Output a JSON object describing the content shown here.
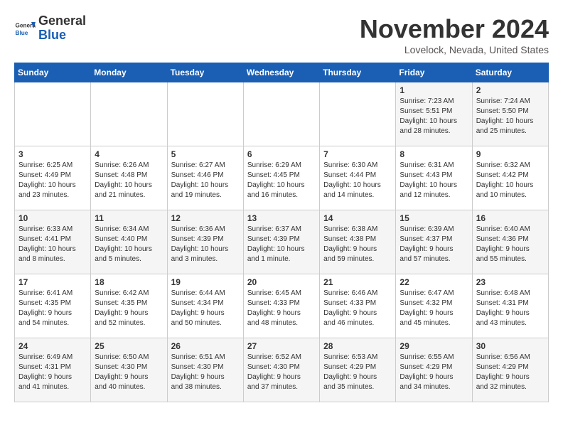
{
  "header": {
    "logo_general": "General",
    "logo_blue": "Blue",
    "month_title": "November 2024",
    "location": "Lovelock, Nevada, United States"
  },
  "calendar": {
    "days_of_week": [
      "Sunday",
      "Monday",
      "Tuesday",
      "Wednesday",
      "Thursday",
      "Friday",
      "Saturday"
    ],
    "weeks": [
      [
        {
          "day": "",
          "info": ""
        },
        {
          "day": "",
          "info": ""
        },
        {
          "day": "",
          "info": ""
        },
        {
          "day": "",
          "info": ""
        },
        {
          "day": "",
          "info": ""
        },
        {
          "day": "1",
          "info": "Sunrise: 7:23 AM\nSunset: 5:51 PM\nDaylight: 10 hours\nand 28 minutes."
        },
        {
          "day": "2",
          "info": "Sunrise: 7:24 AM\nSunset: 5:50 PM\nDaylight: 10 hours\nand 25 minutes."
        }
      ],
      [
        {
          "day": "3",
          "info": "Sunrise: 6:25 AM\nSunset: 4:49 PM\nDaylight: 10 hours\nand 23 minutes."
        },
        {
          "day": "4",
          "info": "Sunrise: 6:26 AM\nSunset: 4:48 PM\nDaylight: 10 hours\nand 21 minutes."
        },
        {
          "day": "5",
          "info": "Sunrise: 6:27 AM\nSunset: 4:46 PM\nDaylight: 10 hours\nand 19 minutes."
        },
        {
          "day": "6",
          "info": "Sunrise: 6:29 AM\nSunset: 4:45 PM\nDaylight: 10 hours\nand 16 minutes."
        },
        {
          "day": "7",
          "info": "Sunrise: 6:30 AM\nSunset: 4:44 PM\nDaylight: 10 hours\nand 14 minutes."
        },
        {
          "day": "8",
          "info": "Sunrise: 6:31 AM\nSunset: 4:43 PM\nDaylight: 10 hours\nand 12 minutes."
        },
        {
          "day": "9",
          "info": "Sunrise: 6:32 AM\nSunset: 4:42 PM\nDaylight: 10 hours\nand 10 minutes."
        }
      ],
      [
        {
          "day": "10",
          "info": "Sunrise: 6:33 AM\nSunset: 4:41 PM\nDaylight: 10 hours\nand 8 minutes."
        },
        {
          "day": "11",
          "info": "Sunrise: 6:34 AM\nSunset: 4:40 PM\nDaylight: 10 hours\nand 5 minutes."
        },
        {
          "day": "12",
          "info": "Sunrise: 6:36 AM\nSunset: 4:39 PM\nDaylight: 10 hours\nand 3 minutes."
        },
        {
          "day": "13",
          "info": "Sunrise: 6:37 AM\nSunset: 4:39 PM\nDaylight: 10 hours\nand 1 minute."
        },
        {
          "day": "14",
          "info": "Sunrise: 6:38 AM\nSunset: 4:38 PM\nDaylight: 9 hours\nand 59 minutes."
        },
        {
          "day": "15",
          "info": "Sunrise: 6:39 AM\nSunset: 4:37 PM\nDaylight: 9 hours\nand 57 minutes."
        },
        {
          "day": "16",
          "info": "Sunrise: 6:40 AM\nSunset: 4:36 PM\nDaylight: 9 hours\nand 55 minutes."
        }
      ],
      [
        {
          "day": "17",
          "info": "Sunrise: 6:41 AM\nSunset: 4:35 PM\nDaylight: 9 hours\nand 54 minutes."
        },
        {
          "day": "18",
          "info": "Sunrise: 6:42 AM\nSunset: 4:35 PM\nDaylight: 9 hours\nand 52 minutes."
        },
        {
          "day": "19",
          "info": "Sunrise: 6:44 AM\nSunset: 4:34 PM\nDaylight: 9 hours\nand 50 minutes."
        },
        {
          "day": "20",
          "info": "Sunrise: 6:45 AM\nSunset: 4:33 PM\nDaylight: 9 hours\nand 48 minutes."
        },
        {
          "day": "21",
          "info": "Sunrise: 6:46 AM\nSunset: 4:33 PM\nDaylight: 9 hours\nand 46 minutes."
        },
        {
          "day": "22",
          "info": "Sunrise: 6:47 AM\nSunset: 4:32 PM\nDaylight: 9 hours\nand 45 minutes."
        },
        {
          "day": "23",
          "info": "Sunrise: 6:48 AM\nSunset: 4:31 PM\nDaylight: 9 hours\nand 43 minutes."
        }
      ],
      [
        {
          "day": "24",
          "info": "Sunrise: 6:49 AM\nSunset: 4:31 PM\nDaylight: 9 hours\nand 41 minutes."
        },
        {
          "day": "25",
          "info": "Sunrise: 6:50 AM\nSunset: 4:30 PM\nDaylight: 9 hours\nand 40 minutes."
        },
        {
          "day": "26",
          "info": "Sunrise: 6:51 AM\nSunset: 4:30 PM\nDaylight: 9 hours\nand 38 minutes."
        },
        {
          "day": "27",
          "info": "Sunrise: 6:52 AM\nSunset: 4:30 PM\nDaylight: 9 hours\nand 37 minutes."
        },
        {
          "day": "28",
          "info": "Sunrise: 6:53 AM\nSunset: 4:29 PM\nDaylight: 9 hours\nand 35 minutes."
        },
        {
          "day": "29",
          "info": "Sunrise: 6:55 AM\nSunset: 4:29 PM\nDaylight: 9 hours\nand 34 minutes."
        },
        {
          "day": "30",
          "info": "Sunrise: 6:56 AM\nSunset: 4:29 PM\nDaylight: 9 hours\nand 32 minutes."
        }
      ]
    ]
  }
}
